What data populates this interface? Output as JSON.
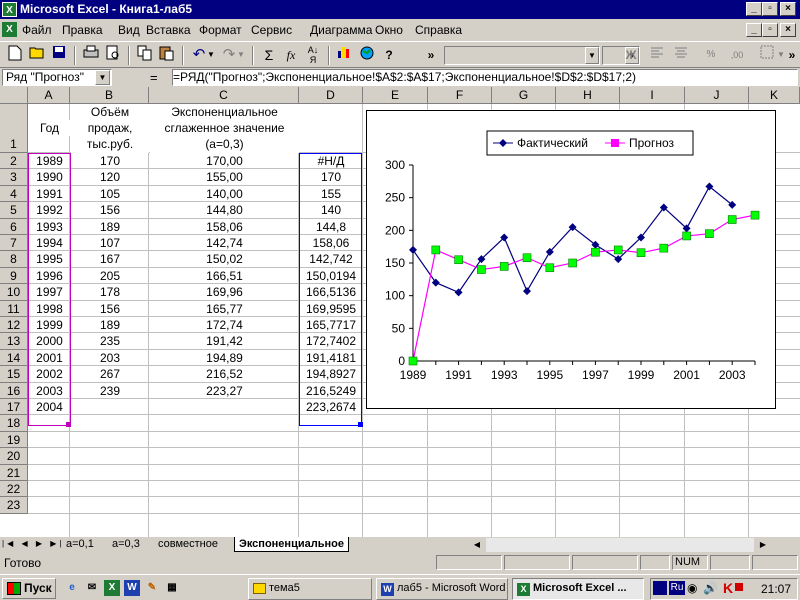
{
  "window": {
    "title": "Microsoft Excel - Книга1-лаб5",
    "app_icon": "excel-icon"
  },
  "menu": [
    "Файл",
    "Правка",
    "Вид",
    "Вставка",
    "Формат",
    "Сервис",
    "Диаграмма",
    "Окно",
    "Справка"
  ],
  "toolbar": {
    "bold": "Ж",
    "chevron": "»"
  },
  "formula_bar": {
    "name_box": "Ряд \"Прогноз\"",
    "eq": "=",
    "formula": "=РЯД(\"Прогноз\";Экспоненциальное!$A$2:$A$17;Экспоненциальное!$D$2:$D$17;2)"
  },
  "columns": [
    "A",
    "B",
    "C",
    "D",
    "E",
    "F",
    "G",
    "H",
    "I",
    "J",
    "K"
  ],
  "rows": [
    "1",
    "2",
    "3",
    "4",
    "5",
    "6",
    "7",
    "8",
    "9",
    "10",
    "11",
    "12",
    "13",
    "14",
    "15",
    "16",
    "17",
    "18",
    "19",
    "20",
    "21",
    "22",
    "23"
  ],
  "headers": {
    "A": "Год",
    "B": [
      "Объём",
      "продаж,",
      "тыс.руб."
    ],
    "C": [
      "Экспоненциальное",
      "сглаженное значение",
      "(a=0,3)"
    ]
  },
  "table": [
    [
      "1989",
      "170",
      "170,00",
      "#Н/Д"
    ],
    [
      "1990",
      "120",
      "155,00",
      "170"
    ],
    [
      "1991",
      "105",
      "140,00",
      "155"
    ],
    [
      "1992",
      "156",
      "144,80",
      "140"
    ],
    [
      "1993",
      "189",
      "158,06",
      "144,8"
    ],
    [
      "1994",
      "107",
      "142,74",
      "158,06"
    ],
    [
      "1995",
      "167",
      "150,02",
      "142,742"
    ],
    [
      "1996",
      "205",
      "166,51",
      "150,0194"
    ],
    [
      "1997",
      "178",
      "169,96",
      "166,5136"
    ],
    [
      "1998",
      "156",
      "165,77",
      "169,9595"
    ],
    [
      "1999",
      "189",
      "172,74",
      "165,7717"
    ],
    [
      "2000",
      "235",
      "191,42",
      "172,7402"
    ],
    [
      "2001",
      "203",
      "194,89",
      "191,4181"
    ],
    [
      "2002",
      "267",
      "216,52",
      "194,8927"
    ],
    [
      "2003",
      "239",
      "223,27",
      "216,5249"
    ],
    [
      "2004",
      "",
      "",
      "223,2674"
    ]
  ],
  "chart_data": {
    "type": "line",
    "x": [
      1989,
      1990,
      1991,
      1992,
      1993,
      1994,
      1995,
      1996,
      1997,
      1998,
      1999,
      2000,
      2001,
      2002,
      2003,
      2004
    ],
    "x_ticks": [
      "1989",
      "1991",
      "1993",
      "1995",
      "1997",
      "1999",
      "2001",
      "2003"
    ],
    "y_ticks": [
      "0",
      "50",
      "100",
      "150",
      "200",
      "250",
      "300"
    ],
    "ylim": [
      0,
      300
    ],
    "legend_position": "top",
    "series": [
      {
        "name": "Фактический",
        "color": "#000080",
        "marker": "diamond",
        "values": [
          170,
          120,
          105,
          156,
          189,
          107,
          167,
          205,
          178,
          156,
          189,
          235,
          203,
          267,
          239,
          null
        ]
      },
      {
        "name": "Прогноз",
        "color": "#ff00ff",
        "marker": "square",
        "marker_fill": "#00ff00",
        "values": [
          0,
          170,
          155,
          140,
          144.8,
          158.06,
          142.742,
          150.0194,
          166.5136,
          169.9595,
          165.7717,
          172.7402,
          191.4181,
          194.8927,
          216.5249,
          223.2674
        ]
      }
    ]
  },
  "sheet_tabs": [
    "a=0,1",
    "a=0,3",
    "совместное",
    "Экспоненциальное"
  ],
  "active_tab": "Экспоненциальное",
  "status": {
    "ready": "Готово",
    "num": "NUM"
  },
  "taskbar": {
    "start": "Пуск",
    "tasks": [
      "тема5",
      "лаб5 - Microsoft Word",
      "Microsoft Excel ..."
    ],
    "lang": "Ru",
    "clock": "21:07"
  }
}
